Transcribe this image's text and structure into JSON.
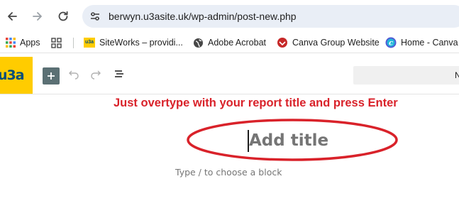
{
  "browser": {
    "url": "berwyn.u3asite.uk/wp-admin/post-new.php",
    "icons": {
      "back": "arrow-back-icon",
      "forward": "arrow-forward-icon",
      "reload": "reload-icon",
      "site_info": "tune-icon"
    }
  },
  "bookmarks": [
    {
      "label": "Apps",
      "icon": "apps-grid-icon"
    },
    {
      "label": "",
      "icon": "app-grid-icon"
    },
    {
      "label": "SiteWorks – providi...",
      "icon": "u3a-favicon"
    },
    {
      "label": "Adobe Acrobat",
      "icon": "globe-icon"
    },
    {
      "label": "Canva Group Website",
      "icon": "canva-group-favicon"
    },
    {
      "label": "Home - Canva",
      "icon": "canva-favicon"
    }
  ],
  "wp_toolbar": {
    "logo_text": "u3a",
    "search_text": "N",
    "icons": {
      "add_block": "plus-icon",
      "undo": "undo-icon",
      "redo": "redo-icon",
      "list_view": "list-view-icon"
    }
  },
  "editor": {
    "instruction": "Just overtype with your report title and press Enter",
    "title_placeholder": "Add title",
    "block_prompt": "Type / to choose a block"
  },
  "colors": {
    "logo_bg": "#ffcc00",
    "logo_text": "#004d7a",
    "instruction": "#d9222a",
    "ellipse": "#d9222a",
    "add_block_bg": "#5b7074",
    "address_bg": "#e9eef6"
  }
}
